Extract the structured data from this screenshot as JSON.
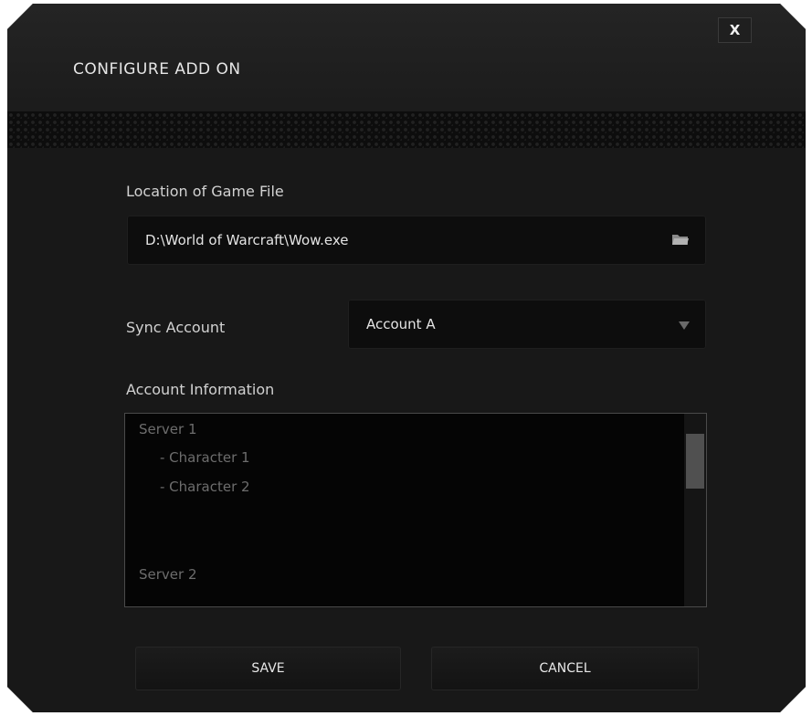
{
  "dialog": {
    "title": "CONFIGURE ADD ON",
    "close_label": "X"
  },
  "game_file": {
    "label": "Location of Game File",
    "value": "D:\\World of Warcraft\\Wow.exe",
    "browse_icon": "folder-icon"
  },
  "sync_account": {
    "label": "Sync Account",
    "selected": "Account A",
    "arrow_icon": "triangle-down-icon"
  },
  "account_info": {
    "label": "Account Information",
    "lines": [
      "Server 1",
      "- Character 1",
      "- Character 2",
      "Server 2"
    ],
    "scroll_fraction": 0.28
  },
  "buttons": {
    "save": "SAVE",
    "cancel": "CANCEL"
  },
  "colors": {
    "background": "#171717",
    "field": "#0d0d0d",
    "text": "#e4e4e4",
    "muted_text": "#6d6d6d"
  }
}
